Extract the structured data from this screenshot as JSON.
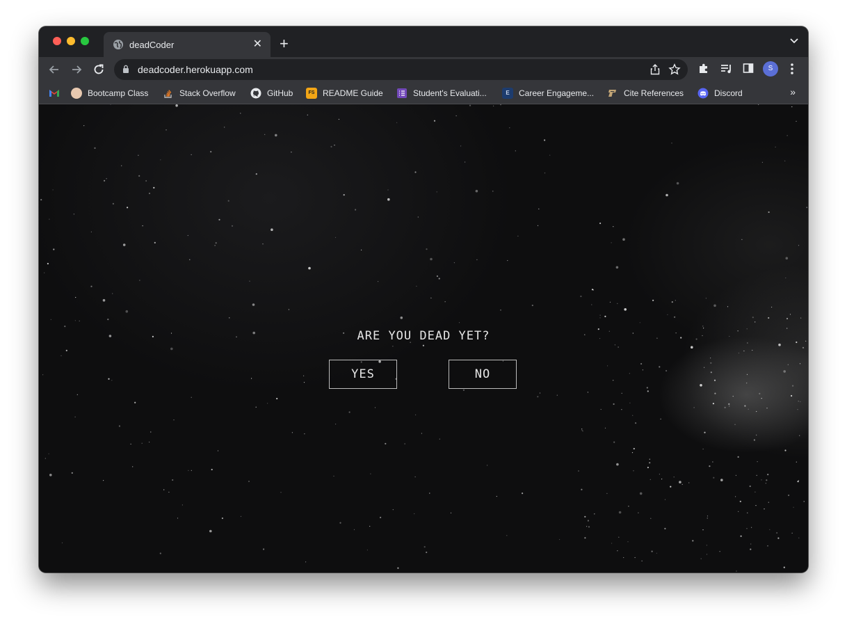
{
  "tab": {
    "title": "deadCoder",
    "icon": "globe-icon"
  },
  "address_bar": {
    "url": "deadcoder.herokuapp.com"
  },
  "profile": {
    "initial": "S"
  },
  "bookmarks": [
    {
      "label": "",
      "icon": "gmail-icon"
    },
    {
      "label": "Bootcamp Class",
      "icon": "bootcamp-icon"
    },
    {
      "label": "Stack Overflow",
      "icon": "stackoverflow-icon"
    },
    {
      "label": "GitHub",
      "icon": "github-icon"
    },
    {
      "label": "README Guide",
      "icon": "readme-icon"
    },
    {
      "label": "Student's Evaluati...",
      "icon": "forms-icon"
    },
    {
      "label": "Career Engageme...",
      "icon": "career-icon"
    },
    {
      "label": "Cite References",
      "icon": "purdue-icon"
    },
    {
      "label": "Discord",
      "icon": "discord-icon"
    }
  ],
  "page": {
    "question": "ARE YOU DEAD YET?",
    "yes_label": "YES",
    "no_label": "NO"
  }
}
